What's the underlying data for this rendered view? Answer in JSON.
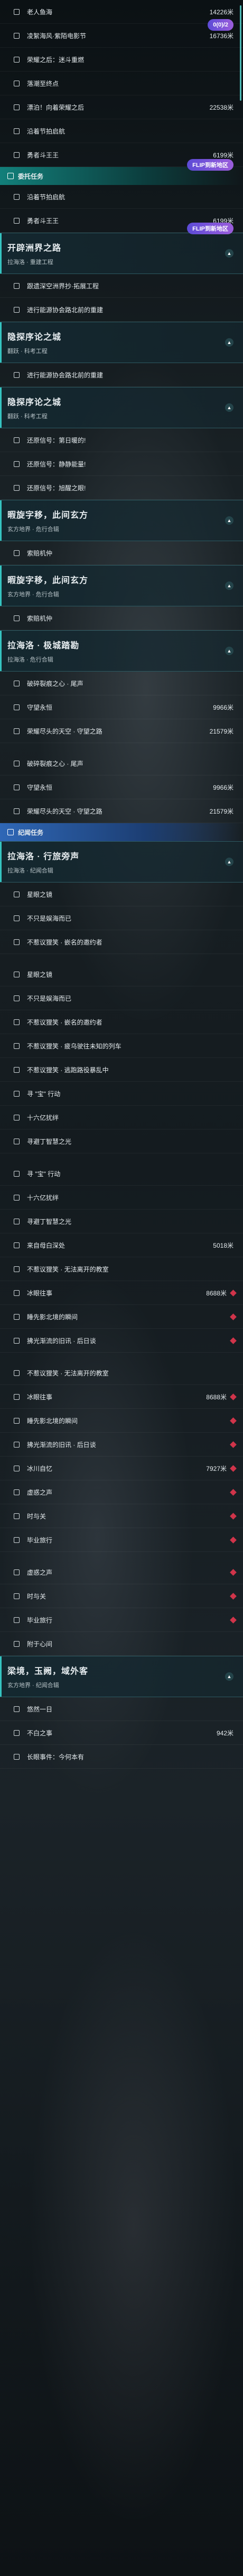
{
  "sections": [
    {
      "kind": "rows",
      "items": [
        {
          "label": "老人鱼海",
          "dist": "14226米"
        },
        {
          "label": "凌絮海风·紫陌电影节",
          "dist": "16736米"
        },
        {
          "label": "荣耀之后：迷斗重燃",
          "dist": ""
        },
        {
          "label": "落潮至终点",
          "dist": ""
        },
        {
          "label": "漂泊！向着荣耀之后",
          "dist": "22538米"
        },
        {
          "label": "沿着节拍启航",
          "dist": ""
        },
        {
          "label": "勇者斗王王",
          "dist": "6199米"
        }
      ]
    },
    {
      "kind": "header",
      "style": "teal",
      "label": "委托任务"
    },
    {
      "kind": "rows",
      "items": [
        {
          "label": "沿着节拍启航",
          "dist": ""
        },
        {
          "label": "勇者斗王王",
          "dist": "6199米"
        }
      ]
    },
    {
      "kind": "quest",
      "title": "开辟洲界之路",
      "sub": "拉海洛 · 重建工程"
    },
    {
      "kind": "rows",
      "items": [
        {
          "label": "跟遗深空洲界抄·拓展工程",
          "dist": ""
        },
        {
          "label": "进行能源协会路北前的重建",
          "dist": ""
        }
      ]
    },
    {
      "kind": "quest",
      "title": "隐探序论之城",
      "sub": "翻跃 · 科考工程"
    },
    {
      "kind": "rows",
      "items": [
        {
          "label": "进行能源协会路北前的重建",
          "dist": ""
        }
      ]
    },
    {
      "kind": "quest",
      "title": "隐探序论之城",
      "sub": "翻跃 · 科考工程"
    },
    {
      "kind": "rows",
      "items": [
        {
          "label": "还原信号：第日暖的!",
          "dist": ""
        },
        {
          "label": "还原信号：静静能量!",
          "dist": ""
        },
        {
          "label": "还原信号：旭醒之眼!",
          "dist": ""
        }
      ]
    },
    {
      "kind": "quest",
      "title": "暇旋字移，此间玄方",
      "sub": "玄方地界 · 危行合辑"
    },
    {
      "kind": "rows",
      "items": [
        {
          "label": "索赔机仲",
          "dist": ""
        }
      ]
    },
    {
      "kind": "quest",
      "title": "暇旋字移，此间玄方",
      "sub": "玄方地界 · 危行合辑"
    },
    {
      "kind": "rows",
      "items": [
        {
          "label": "索赔机仲",
          "dist": ""
        }
      ]
    },
    {
      "kind": "quest",
      "title": "拉海洛 · 极城踏勘",
      "sub": "拉海洛 · 危行合辑"
    },
    {
      "kind": "rows",
      "items": [
        {
          "label": "破碎裂痕之心 · 尾声",
          "dist": ""
        },
        {
          "label": "守望永恒",
          "dist": "9966米"
        },
        {
          "label": "荣耀尽头的天空 · 守望之路",
          "dist": "21579米"
        }
      ]
    },
    {
      "kind": "spacer"
    },
    {
      "kind": "rows",
      "items": [
        {
          "label": "破碎裂痕之心 · 尾声",
          "dist": ""
        },
        {
          "label": "守望永恒",
          "dist": "9966米"
        },
        {
          "label": "荣耀尽头的天空 · 守望之路",
          "dist": "21579米"
        }
      ]
    },
    {
      "kind": "header",
      "style": "blue",
      "label": "纪闻任务"
    },
    {
      "kind": "quest",
      "title": "拉海洛 · 行旅旁声",
      "sub": "拉海洛 · 纪闻合辑"
    },
    {
      "kind": "rows",
      "items": [
        {
          "label": "星眼之镜",
          "dist": ""
        },
        {
          "label": "不只是娱海而已",
          "dist": ""
        },
        {
          "label": "不惹议狸笑 · 嵌名的邀约者",
          "dist": ""
        }
      ]
    },
    {
      "kind": "spacer"
    },
    {
      "kind": "rows",
      "items": [
        {
          "label": "星眼之镜",
          "dist": ""
        },
        {
          "label": "不只是娱海而已",
          "dist": ""
        },
        {
          "label": "不惹议狸笑 · 嵌名的邀约者",
          "dist": ""
        },
        {
          "label": "不惹议狸笑 · 疲乌驶往未知的列车",
          "dist": ""
        },
        {
          "label": "不惹议狸笑 · 逃跑路役暴乱中",
          "dist": ""
        },
        {
          "label": "寻 \"宝\" 行动",
          "dist": ""
        },
        {
          "label": "十六亿扰绊",
          "dist": ""
        },
        {
          "label": "寻避丁智慧之光",
          "dist": ""
        }
      ]
    },
    {
      "kind": "spacer"
    },
    {
      "kind": "rows",
      "items": [
        {
          "label": "寻 \"宝\" 行动",
          "dist": ""
        },
        {
          "label": "十六亿扰绊",
          "dist": ""
        },
        {
          "label": "寻避丁智慧之光",
          "dist": ""
        },
        {
          "label": "来自母白深处",
          "dist": "5018米"
        },
        {
          "label": "不惹议狸笑 · 无法离开的教室",
          "dist": ""
        },
        {
          "label": "冰眼往事",
          "dist": "8688米",
          "mk": true
        },
        {
          "label": "睡先影北境的瞬间",
          "dist": "",
          "mk": true
        },
        {
          "label": "拂光渐流的旧讯 · 后日谈",
          "dist": "",
          "mk": true
        }
      ]
    },
    {
      "kind": "spacer"
    },
    {
      "kind": "rows",
      "items": [
        {
          "label": "不惹议狸笑 · 无法离开的教室",
          "dist": ""
        },
        {
          "label": "冰眼往事",
          "dist": "8688米",
          "mk": true
        },
        {
          "label": "睡先影北境的瞬间",
          "dist": "",
          "mk": true
        },
        {
          "label": "拂光渐流的旧讯 · 后日谈",
          "dist": "",
          "mk": true
        },
        {
          "label": "冰川自忆",
          "dist": "7927米",
          "mk": true
        },
        {
          "label": "虚惑之声",
          "dist": "",
          "mk": true
        },
        {
          "label": "时与关",
          "dist": "",
          "mk": true
        },
        {
          "label": "毕业旅行",
          "dist": "",
          "mk": true
        }
      ]
    },
    {
      "kind": "spacer"
    },
    {
      "kind": "rows",
      "items": [
        {
          "label": "虚惑之声",
          "dist": "",
          "mk": true
        },
        {
          "label": "时与关",
          "dist": "",
          "mk": true
        },
        {
          "label": "毕业旅行",
          "dist": "",
          "mk": true
        },
        {
          "label": "附于心间",
          "dist": ""
        }
      ]
    },
    {
      "kind": "quest",
      "title": "梁境，玉阙，域外客",
      "sub": "玄方地界 · 纪闻合辑"
    },
    {
      "kind": "rows",
      "items": [
        {
          "label": "悠然一日",
          "dist": ""
        },
        {
          "label": "不白之事",
          "dist": "942米"
        },
        {
          "label": "长眼事件：今何本有",
          "dist": ""
        }
      ]
    }
  ],
  "banners": [
    {
      "label": "0(0)/2"
    },
    {
      "label": "FLIP到新地区"
    },
    {
      "label": "FLIP到新地区"
    }
  ]
}
